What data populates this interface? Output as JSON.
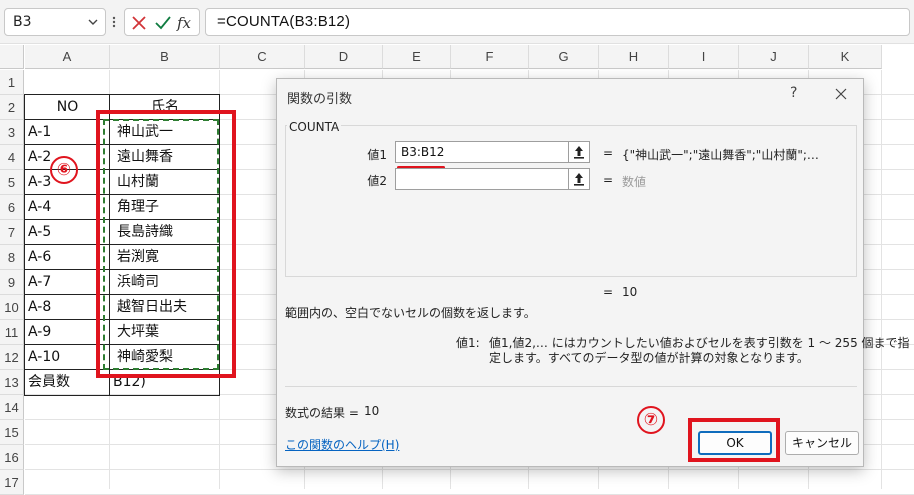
{
  "formula_bar": {
    "name_box": "B3",
    "formula": "=COUNTA(B3:B12)",
    "fx_label": "fx"
  },
  "columns": [
    "A",
    "B",
    "C",
    "D",
    "E",
    "F",
    "G",
    "H",
    "I",
    "J",
    "K"
  ],
  "rows": [
    "1",
    "2",
    "3",
    "4",
    "5",
    "6",
    "7",
    "8",
    "9",
    "10",
    "11",
    "12",
    "13",
    "14",
    "15",
    "16",
    "17"
  ],
  "sheet": {
    "header": {
      "no": "NO",
      "name": "氏名"
    },
    "records": [
      {
        "no": "A-1",
        "name": "神山武一"
      },
      {
        "no": "A-2",
        "name": "遠山舞香"
      },
      {
        "no": "A-3",
        "name": "山村蘭"
      },
      {
        "no": "A-4",
        "name": "角理子"
      },
      {
        "no": "A-5",
        "name": "長島詩織"
      },
      {
        "no": "A-6",
        "name": "岩渕寛"
      },
      {
        "no": "A-7",
        "name": "浜崎司"
      },
      {
        "no": "A-8",
        "name": "越智日出夫"
      },
      {
        "no": "A-9",
        "name": "大坪葉"
      },
      {
        "no": "A-10",
        "name": "神崎愛梨"
      }
    ],
    "footer": {
      "label": "会員数",
      "value": "B12)"
    }
  },
  "annotations": {
    "step6": "⑥",
    "step7": "⑦"
  },
  "dialog": {
    "title": "関数の引数",
    "help_glyph": "?",
    "function_name": "COUNTA",
    "arg1": {
      "label": "値1",
      "value": "B3:B12",
      "result": "{\"神山武一\";\"遠山舞香\";\"山村蘭\";…"
    },
    "arg2": {
      "label": "値2",
      "value": "",
      "result": "数値"
    },
    "eq": "=",
    "overall_result": "10",
    "description": "範囲内の、空白でないセルの個数を返します。",
    "arg_help_label": "値1:",
    "arg_help_line1": "値1,値2,… にはカウントしたい値およびセルを表す引数を 1 ～ 255 個まで指",
    "arg_help_line2": "定します。すべてのデータ型の値が計算の対象となります。",
    "formula_result_label": "数式の結果 =",
    "formula_result_value": "10",
    "help_link": "この関数のヘルプ(H)",
    "ok_label": "OK",
    "cancel_label": "キャンセル"
  },
  "colors": {
    "annotation_red": "#e0141e",
    "marching_ants": "#2e7d32",
    "ok_border": "#0f6cbd",
    "link": "#0563c1"
  }
}
